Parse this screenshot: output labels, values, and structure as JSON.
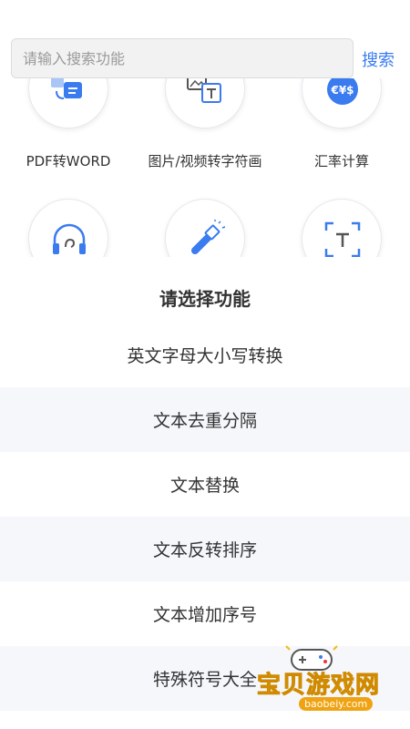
{
  "search": {
    "placeholder": "请输入搜索功能",
    "button_label": "搜索"
  },
  "tools": [
    {
      "label": "PDF转WORD",
      "icon": "pdf-to-word-icon"
    },
    {
      "label": "图片/视频转字符画",
      "icon": "image-to-text-icon"
    },
    {
      "label": "汇率计算",
      "icon": "currency-exchange-icon"
    },
    {
      "label": "",
      "icon": "headphones-icon"
    },
    {
      "label": "",
      "icon": "flashlight-icon"
    },
    {
      "label": "",
      "icon": "text-scan-icon"
    }
  ],
  "sheet": {
    "title": "请选择功能",
    "options": [
      "英文字母大小写转换",
      "文本去重分隔",
      "文本替换",
      "文本反转排序",
      "文本增加序号",
      "特殊符号大全"
    ]
  },
  "watermark": {
    "text": "宝贝游戏网",
    "url": "baobeiy.com"
  },
  "colors": {
    "accent": "#3a7bf0",
    "alt_row": "#f5f7fb",
    "watermark": "#f7b718"
  }
}
